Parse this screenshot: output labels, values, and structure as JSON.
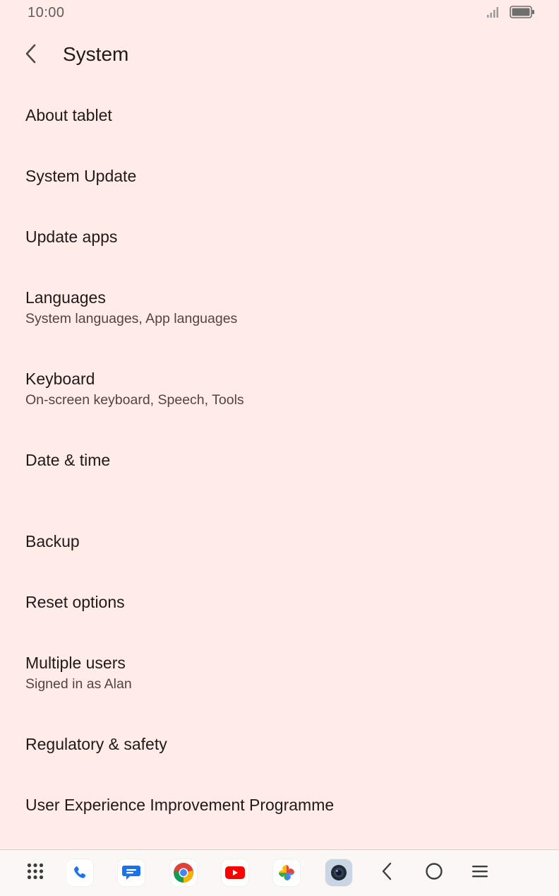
{
  "status_bar": {
    "time": "10:00",
    "icons": [
      "signal-icon",
      "battery-icon"
    ]
  },
  "header": {
    "title": "System",
    "back_icon": "back-arrow-icon"
  },
  "items": [
    {
      "title": "About tablet",
      "subtitle": ""
    },
    {
      "title": "System Update",
      "subtitle": ""
    },
    {
      "title": "Update apps",
      "subtitle": ""
    },
    {
      "title": "Languages",
      "subtitle": "System languages, App languages"
    },
    {
      "title": "Keyboard",
      "subtitle": "On-screen keyboard, Speech, Tools"
    },
    {
      "title": "Date & time",
      "subtitle": ""
    },
    {
      "title": "Backup",
      "subtitle": ""
    },
    {
      "title": "Reset options",
      "subtitle": ""
    },
    {
      "title": "Multiple users",
      "subtitle": "Signed in as Alan"
    },
    {
      "title": "Regulatory & safety",
      "subtitle": ""
    },
    {
      "title": "User Experience Improvement Programme",
      "subtitle": ""
    }
  ],
  "nav_bar": {
    "apps": [
      "app-drawer-icon",
      "phone-icon",
      "messages-icon",
      "chrome-icon",
      "youtube-icon",
      "photos-icon",
      "camera-icon"
    ],
    "system_buttons": [
      "back-icon",
      "home-icon",
      "recents-icon"
    ]
  },
  "colors": {
    "background": "#ffebe8",
    "text_primary": "#201a19",
    "text_secondary": "#534341"
  }
}
